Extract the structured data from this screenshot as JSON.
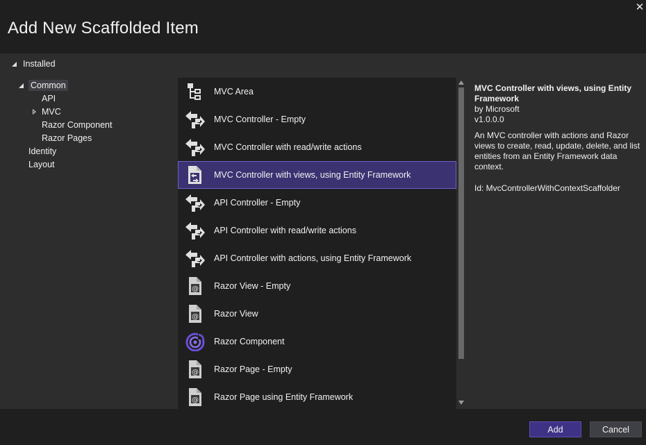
{
  "dialog": {
    "title": "Add New Scaffolded Item",
    "close_glyph": "✕"
  },
  "tree": {
    "root_label": "Installed",
    "nodes": [
      {
        "label": "Common",
        "expanded": true,
        "selected": true
      },
      {
        "label": "API"
      },
      {
        "label": "MVC",
        "expanded": false
      },
      {
        "label": "Razor Component"
      },
      {
        "label": "Razor Pages"
      },
      {
        "label": "Identity"
      },
      {
        "label": "Layout"
      }
    ]
  },
  "list": {
    "selected_index": 3,
    "items": [
      {
        "label": "MVC Area",
        "icon": "area-folder-icon"
      },
      {
        "label": "MVC Controller - Empty",
        "icon": "controller-icon"
      },
      {
        "label": "MVC Controller with read/write actions",
        "icon": "controller-icon"
      },
      {
        "label": "MVC Controller with views, using Entity Framework",
        "icon": "controller-views-icon"
      },
      {
        "label": "API Controller - Empty",
        "icon": "controller-icon"
      },
      {
        "label": "API Controller with read/write actions",
        "icon": "controller-icon"
      },
      {
        "label": "API Controller with actions, using Entity Framework",
        "icon": "controller-icon"
      },
      {
        "label": "Razor View - Empty",
        "icon": "razor-file-icon"
      },
      {
        "label": "Razor View",
        "icon": "razor-file-icon"
      },
      {
        "label": "Razor Component",
        "icon": "blazor-icon"
      },
      {
        "label": "Razor Page - Empty",
        "icon": "razor-file-icon"
      },
      {
        "label": "Razor Page using Entity Framework",
        "icon": "razor-file-icon"
      }
    ]
  },
  "details": {
    "title": "MVC Controller with views, using Entity Framework",
    "author": "by Microsoft",
    "version": "v1.0.0.0",
    "description": "An MVC controller with actions and Razor views to create, read, update, delete, and list entities from an Entity Framework data context.",
    "id": "Id: MvcControllerWithContextScaffolder"
  },
  "footer": {
    "add_label": "Add",
    "cancel_label": "Cancel"
  },
  "colors": {
    "accent": "#3e3286",
    "selection": "#3b3271",
    "background": "#1f1f1f",
    "panel": "#2d2d2d"
  }
}
